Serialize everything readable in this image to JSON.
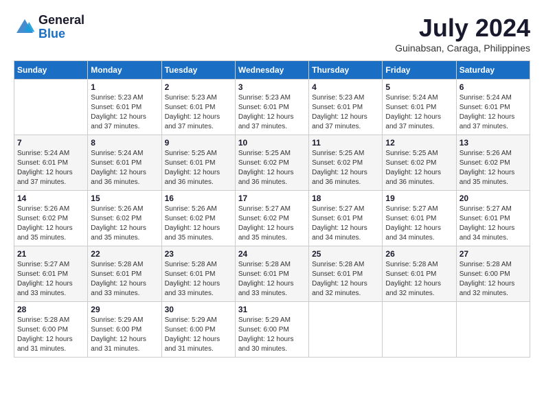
{
  "header": {
    "logo_general": "General",
    "logo_blue": "Blue",
    "month_year": "July 2024",
    "location": "Guinabsan, Caraga, Philippines"
  },
  "days_of_week": [
    "Sunday",
    "Monday",
    "Tuesday",
    "Wednesday",
    "Thursday",
    "Friday",
    "Saturday"
  ],
  "weeks": [
    [
      {
        "day": "",
        "info": ""
      },
      {
        "day": "1",
        "info": "Sunrise: 5:23 AM\nSunset: 6:01 PM\nDaylight: 12 hours\nand 37 minutes."
      },
      {
        "day": "2",
        "info": "Sunrise: 5:23 AM\nSunset: 6:01 PM\nDaylight: 12 hours\nand 37 minutes."
      },
      {
        "day": "3",
        "info": "Sunrise: 5:23 AM\nSunset: 6:01 PM\nDaylight: 12 hours\nand 37 minutes."
      },
      {
        "day": "4",
        "info": "Sunrise: 5:23 AM\nSunset: 6:01 PM\nDaylight: 12 hours\nand 37 minutes."
      },
      {
        "day": "5",
        "info": "Sunrise: 5:24 AM\nSunset: 6:01 PM\nDaylight: 12 hours\nand 37 minutes."
      },
      {
        "day": "6",
        "info": "Sunrise: 5:24 AM\nSunset: 6:01 PM\nDaylight: 12 hours\nand 37 minutes."
      }
    ],
    [
      {
        "day": "7",
        "info": "Sunrise: 5:24 AM\nSunset: 6:01 PM\nDaylight: 12 hours\nand 37 minutes."
      },
      {
        "day": "8",
        "info": "Sunrise: 5:24 AM\nSunset: 6:01 PM\nDaylight: 12 hours\nand 36 minutes."
      },
      {
        "day": "9",
        "info": "Sunrise: 5:25 AM\nSunset: 6:01 PM\nDaylight: 12 hours\nand 36 minutes."
      },
      {
        "day": "10",
        "info": "Sunrise: 5:25 AM\nSunset: 6:02 PM\nDaylight: 12 hours\nand 36 minutes."
      },
      {
        "day": "11",
        "info": "Sunrise: 5:25 AM\nSunset: 6:02 PM\nDaylight: 12 hours\nand 36 minutes."
      },
      {
        "day": "12",
        "info": "Sunrise: 5:25 AM\nSunset: 6:02 PM\nDaylight: 12 hours\nand 36 minutes."
      },
      {
        "day": "13",
        "info": "Sunrise: 5:26 AM\nSunset: 6:02 PM\nDaylight: 12 hours\nand 35 minutes."
      }
    ],
    [
      {
        "day": "14",
        "info": "Sunrise: 5:26 AM\nSunset: 6:02 PM\nDaylight: 12 hours\nand 35 minutes."
      },
      {
        "day": "15",
        "info": "Sunrise: 5:26 AM\nSunset: 6:02 PM\nDaylight: 12 hours\nand 35 minutes."
      },
      {
        "day": "16",
        "info": "Sunrise: 5:26 AM\nSunset: 6:02 PM\nDaylight: 12 hours\nand 35 minutes."
      },
      {
        "day": "17",
        "info": "Sunrise: 5:27 AM\nSunset: 6:02 PM\nDaylight: 12 hours\nand 35 minutes."
      },
      {
        "day": "18",
        "info": "Sunrise: 5:27 AM\nSunset: 6:01 PM\nDaylight: 12 hours\nand 34 minutes."
      },
      {
        "day": "19",
        "info": "Sunrise: 5:27 AM\nSunset: 6:01 PM\nDaylight: 12 hours\nand 34 minutes."
      },
      {
        "day": "20",
        "info": "Sunrise: 5:27 AM\nSunset: 6:01 PM\nDaylight: 12 hours\nand 34 minutes."
      }
    ],
    [
      {
        "day": "21",
        "info": "Sunrise: 5:27 AM\nSunset: 6:01 PM\nDaylight: 12 hours\nand 33 minutes."
      },
      {
        "day": "22",
        "info": "Sunrise: 5:28 AM\nSunset: 6:01 PM\nDaylight: 12 hours\nand 33 minutes."
      },
      {
        "day": "23",
        "info": "Sunrise: 5:28 AM\nSunset: 6:01 PM\nDaylight: 12 hours\nand 33 minutes."
      },
      {
        "day": "24",
        "info": "Sunrise: 5:28 AM\nSunset: 6:01 PM\nDaylight: 12 hours\nand 33 minutes."
      },
      {
        "day": "25",
        "info": "Sunrise: 5:28 AM\nSunset: 6:01 PM\nDaylight: 12 hours\nand 32 minutes."
      },
      {
        "day": "26",
        "info": "Sunrise: 5:28 AM\nSunset: 6:01 PM\nDaylight: 12 hours\nand 32 minutes."
      },
      {
        "day": "27",
        "info": "Sunrise: 5:28 AM\nSunset: 6:00 PM\nDaylight: 12 hours\nand 32 minutes."
      }
    ],
    [
      {
        "day": "28",
        "info": "Sunrise: 5:28 AM\nSunset: 6:00 PM\nDaylight: 12 hours\nand 31 minutes."
      },
      {
        "day": "29",
        "info": "Sunrise: 5:29 AM\nSunset: 6:00 PM\nDaylight: 12 hours\nand 31 minutes."
      },
      {
        "day": "30",
        "info": "Sunrise: 5:29 AM\nSunset: 6:00 PM\nDaylight: 12 hours\nand 31 minutes."
      },
      {
        "day": "31",
        "info": "Sunrise: 5:29 AM\nSunset: 6:00 PM\nDaylight: 12 hours\nand 30 minutes."
      },
      {
        "day": "",
        "info": ""
      },
      {
        "day": "",
        "info": ""
      },
      {
        "day": "",
        "info": ""
      }
    ]
  ]
}
